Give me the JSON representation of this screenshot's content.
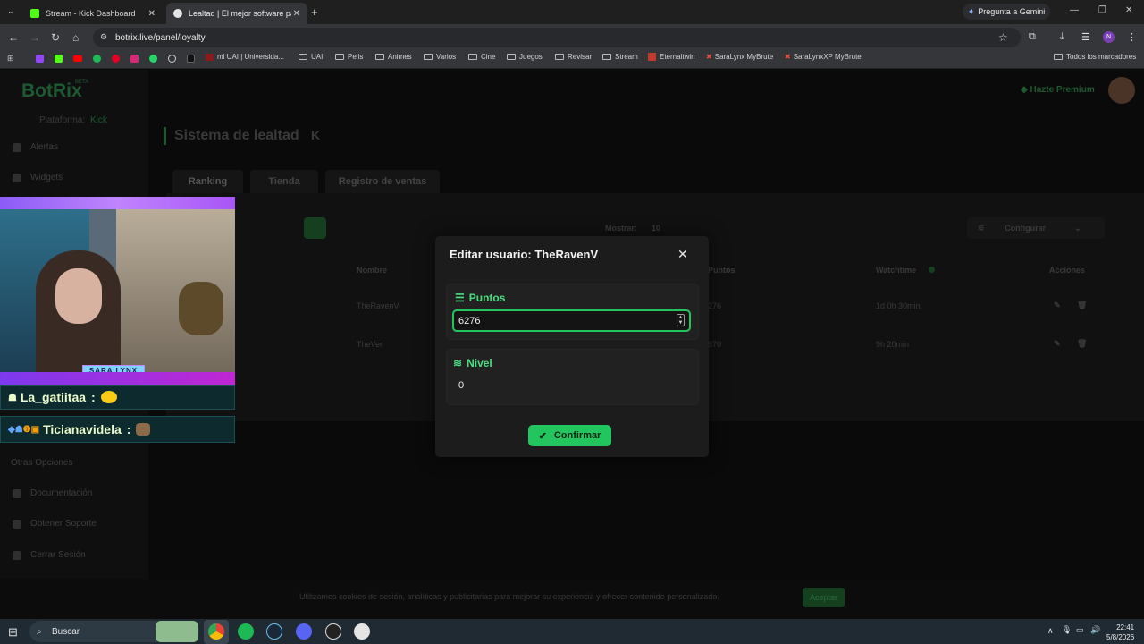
{
  "browser": {
    "tabs": [
      {
        "label": "Stream - Kick Dashboard",
        "active": false
      },
      {
        "label": "Lealtad | El mejor software para",
        "active": true
      }
    ],
    "gemini_button": "Pregunta a Gemini",
    "url": "botrix.live/panel/loyalty",
    "profile_initial": "N",
    "bookmarks": [
      "mi UAI | Universida...",
      "UAI",
      "Pelis",
      "Animes",
      "Varios",
      "Cine",
      "Juegos",
      "Revisar",
      "Stream",
      "Eternaltwin",
      "SaraLynx MyBrute",
      "SaraLynxXP MyBrute"
    ],
    "all_bookmarks": "Todos los marcadores"
  },
  "app": {
    "logo": "BotRix",
    "logo_badge": "BETA",
    "platform_label": "Plataforma:",
    "platform_value": "Kick",
    "premium": "Hazte Premium",
    "sidebar": {
      "items": [
        "Alertas",
        "Widgets"
      ],
      "section": "Otras Opciones",
      "other_items": [
        "Documentación",
        "Obtener Soporte",
        "Cerrar Sesión"
      ]
    },
    "page_title": "Sistema de lealtad",
    "tabs": [
      "Ranking",
      "Tienda",
      "Registro de ventas"
    ],
    "show_label": "Mostrar:",
    "show_value": "10",
    "configure": "Configurar",
    "table": {
      "columns": [
        "Nombre",
        "Puntos",
        "Watchtime",
        "Acciones"
      ],
      "rows": [
        {
          "name": "TheRavenV",
          "points": "276",
          "watchtime": "1d 0h 30min"
        },
        {
          "name": "TheVer",
          "points": "670",
          "watchtime": "9h 20min"
        }
      ]
    }
  },
  "overlay": {
    "cam_name": "SARA LYNX",
    "chat": [
      {
        "user": "La_gatiitaa",
        "sep": ":"
      },
      {
        "user": "Ticianavidela",
        "sep": ":"
      }
    ]
  },
  "modal": {
    "title": "Editar usuario: TheRavenV",
    "puntos_label": "Puntos",
    "puntos_value": "6276",
    "nivel_label": "Nivel",
    "nivel_value": "0",
    "confirm": "Confirmar"
  },
  "cookie": {
    "text": "Utilizamos cookies de sesión, analíticas y publicitarias para mejorar su experiencia y ofrecer contenido personalizado.",
    "accept": "Aceptar"
  },
  "taskbar": {
    "search": "Buscar",
    "time": "22:41",
    "date": "5/8/2026"
  },
  "colors": {
    "accent": "#22c55e",
    "modal_bg": "#1c1c1c",
    "chrome_bg": "#35363a"
  }
}
